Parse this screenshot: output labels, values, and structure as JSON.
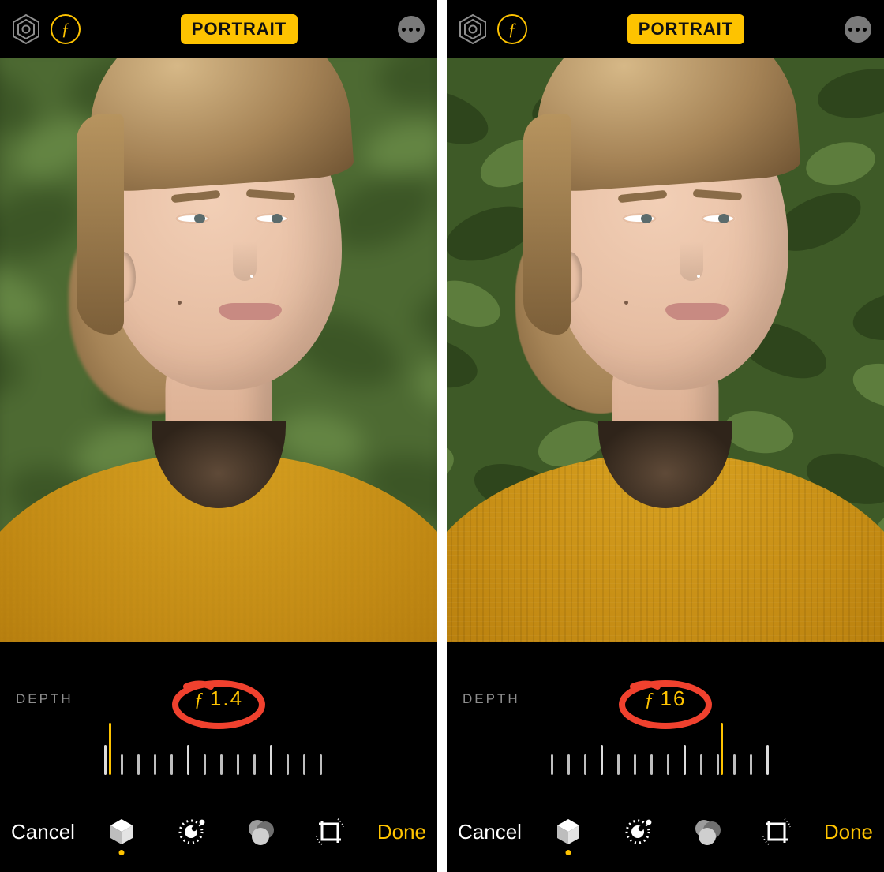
{
  "mode_label": "PORTRAIT",
  "depth_label": "DEPTH",
  "cancel_label": "Cancel",
  "done_label": "Done",
  "f_glyph": "ƒ",
  "colors": {
    "accent": "#fec300",
    "annotation": "#f0412e"
  },
  "panels": [
    {
      "id": "left",
      "f_value": "1.4",
      "ruler_indicator_percent": 2,
      "background_blur": true
    },
    {
      "id": "right",
      "f_value": "16",
      "ruler_indicator_percent": 74,
      "background_blur": false
    }
  ],
  "tools": [
    {
      "name": "lighting",
      "active": true
    },
    {
      "name": "adjust",
      "active": false
    },
    {
      "name": "filters",
      "active": false
    },
    {
      "name": "crop",
      "active": false
    }
  ]
}
